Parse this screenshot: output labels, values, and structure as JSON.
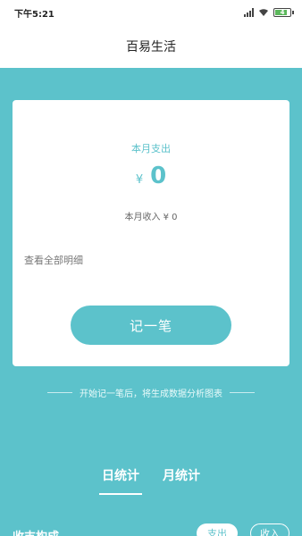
{
  "status_bar": {
    "time": "下午5:21",
    "battery_level": "4"
  },
  "header": {
    "title": "百易生活"
  },
  "summary": {
    "month_expense_label": "本月支出",
    "currency": "¥",
    "month_expense_amount": "0",
    "month_income_text": "本月收入 ¥ 0",
    "view_all_label": "查看全部明细",
    "record_button_label": "记一笔"
  },
  "hint": {
    "text": "开始记一笔后，将生成数据分析图表"
  },
  "stats_tabs": [
    {
      "label": "日统计",
      "active": true
    },
    {
      "label": "月统计",
      "active": false
    }
  ],
  "composition": {
    "title": "收支构成",
    "toggle_expense": "支出",
    "toggle_income": "收入"
  },
  "colors": {
    "accent": "#5cc2cb",
    "header_bg": "#ffffff"
  }
}
